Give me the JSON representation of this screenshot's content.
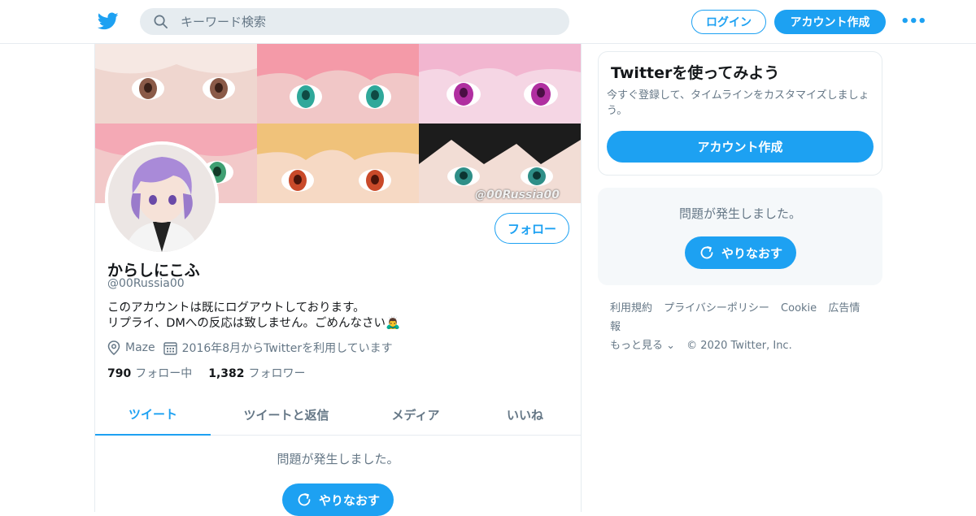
{
  "header": {
    "search_placeholder": "キーワード検索",
    "login_label": "ログイン",
    "signup_label": "アカウント作成",
    "more_label": "•••"
  },
  "profile": {
    "banner_watermark": "@00Russia00",
    "follow_label": "フォロー",
    "display_name": "からしにこふ",
    "handle": "@00Russia00",
    "bio_line1": "このアカウントは既にログアウトしております。",
    "bio_line2": "リプライ、DMへの反応は致しません。ごめんなさい🙇‍♂️",
    "location": "Maze",
    "joined": "2016年8月からTwitterを利用しています",
    "following_count": "790",
    "following_label": "フォロー中",
    "followers_count": "1,382",
    "followers_label": "フォロワー"
  },
  "tabs": [
    {
      "label": "ツイート",
      "active": true
    },
    {
      "label": "ツイートと返信",
      "active": false
    },
    {
      "label": "メディア",
      "active": false
    },
    {
      "label": "いいね",
      "active": false
    }
  ],
  "timeline": {
    "error_message": "問題が発生しました。",
    "retry_label": "やりなおす"
  },
  "sidebar": {
    "signup_card": {
      "title": "Twitterを使ってみよう",
      "description": "今すぐ登録して、タイムラインをカスタマイズしましょう。",
      "button_label": "アカウント作成"
    },
    "error_card": {
      "message": "問題が発生しました。",
      "retry_label": "やりなおす"
    },
    "footer": {
      "links": [
        "利用規約",
        "プライバシーポリシー",
        "Cookie",
        "広告情報"
      ],
      "more_label": "もっと見る ⌄",
      "copyright": "© 2020 Twitter, Inc."
    }
  },
  "colors": {
    "accent": "#1da1f2",
    "secondary_text": "#657786",
    "border": "#e6ecf0"
  }
}
